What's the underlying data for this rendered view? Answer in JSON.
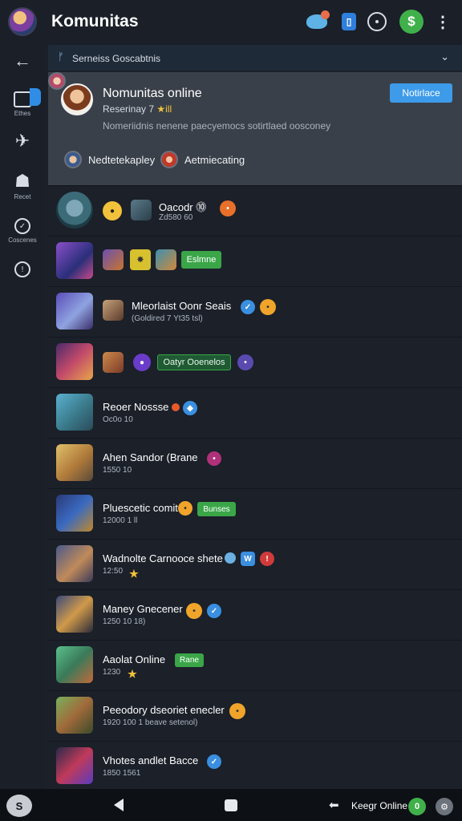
{
  "app": {
    "title": "Komunitas"
  },
  "topbar": {
    "icons": [
      "bird-icon",
      "badge-icon",
      "clock-icon",
      "dollar-icon",
      "more-icon"
    ],
    "badge_text": "▯",
    "dollar_text": "$",
    "more_text": "⋮"
  },
  "rail": {
    "items": [
      {
        "name": "back-arrow-icon",
        "glyph": "←",
        "label": ""
      },
      {
        "name": "notes-icon",
        "glyph": "",
        "label": "Ethes"
      },
      {
        "name": "pin-icon",
        "glyph": "✈",
        "label": ""
      },
      {
        "name": "bag-icon",
        "glyph": "☗",
        "label": "Recet"
      },
      {
        "name": "check-circle-icon",
        "glyph": "✓",
        "label": "Coscenes"
      },
      {
        "name": "info-circle-icon",
        "glyph": "!",
        "label": ""
      }
    ]
  },
  "dropdown": {
    "mark": "ᚠ",
    "label": "Serneiss Goscabtnis",
    "chevron": "⌄"
  },
  "panel": {
    "title": "Nomunitas online",
    "subtitle": "Reserinay 7",
    "stars": "★ill",
    "description": "Nomeriidnis nenene paecyemocs sotirtlaed oosconey",
    "button": "Notirlace",
    "chip1": "Nedtetekapley",
    "chip2": "Aetmiecating"
  },
  "rows": [
    {
      "title": "Oacodr  ⓾",
      "sub": "Zd580 60",
      "pill": ""
    },
    {
      "title": "",
      "sub": "",
      "pill": "Eslmne"
    },
    {
      "title": "Mleorlaist Oonr Seais",
      "sub": "(Goldired 7 Yt35 tsl)",
      "pill": ""
    },
    {
      "title": "",
      "sub": "",
      "pill": "Oatyr Ooenelos"
    },
    {
      "title": "Reoer Nossse",
      "sub": "Oc0o 10",
      "pill": ""
    },
    {
      "title": "Ahen Sandor (Brane",
      "sub": "1550 10",
      "pill": ""
    },
    {
      "title": "Pluescetic comit",
      "sub": "12000 1 ll",
      "pill": "Bunses"
    },
    {
      "title": "Wadnolte Carnooce shete",
      "sub": "12:50",
      "pill": ""
    },
    {
      "title": "Maney Gnecener",
      "sub": "1250 10 18)",
      "pill": ""
    },
    {
      "title": "Aaolat Online",
      "sub": "1230",
      "pill": "Rane"
    },
    {
      "title": "Peeodory dseoriet enecler",
      "sub": "1920 100 1 beave setenol)",
      "pill": ""
    },
    {
      "title": "Vhotes andlet Bacce",
      "sub": "1850 1561",
      "pill": ""
    }
  ],
  "bottomnav": {
    "home": "S",
    "arrow": "⬅",
    "label": "Keegr Online",
    "green": "0",
    "grey": "⚙"
  },
  "colors": {
    "background": "#1b2029",
    "panel": "#3a4049",
    "accent_blue": "#3d9be9",
    "accent_green": "#3fb04a"
  }
}
